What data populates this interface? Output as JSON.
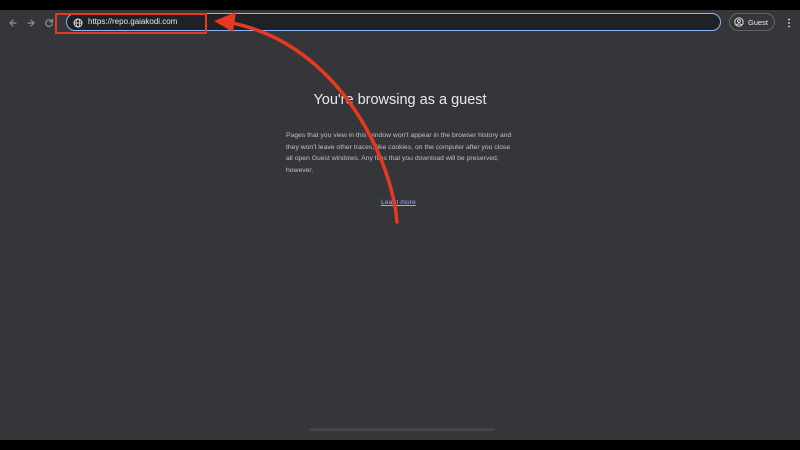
{
  "toolbar": {
    "url": "https://repo.gaiakodi.com",
    "profile_label": "Guest"
  },
  "guest_page": {
    "heading": "You're browsing as a guest",
    "body": "Pages that you view in this window won't appear in the browser history and they won't leave other traces, like cookies, on the computer after you close all open Guest windows. Any files that you download will be preserved, however.",
    "learn_more": "Learn more"
  },
  "icons": {
    "back": "arrow-left-icon",
    "forward": "arrow-right-icon",
    "reload": "reload-icon",
    "site_info": "globe-icon",
    "profile": "account-circle-icon",
    "menu": "kebab-menu-icon"
  },
  "colors": {
    "background": "#35363a",
    "omnibox_focus_border": "#8ab4f8",
    "link": "#8ab4f8",
    "annotation": "#e8381f"
  }
}
